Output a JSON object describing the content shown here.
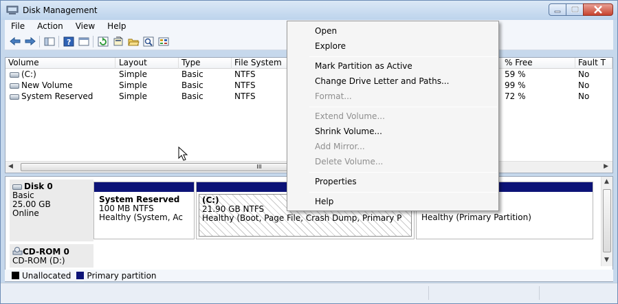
{
  "window": {
    "title": "Disk Management"
  },
  "menubar": [
    "File",
    "Action",
    "View",
    "Help"
  ],
  "toolbar": {
    "buttons": [
      "back-icon",
      "forward-icon",
      "console-tree-icon",
      "help-icon",
      "properties-icon",
      "refresh-icon",
      "rescan-icon",
      "open-icon",
      "find-icon",
      "view-icon"
    ]
  },
  "volumes": {
    "columns": [
      "Volume",
      "Layout",
      "Type",
      "File System",
      "% Free",
      "Fault T"
    ],
    "rows": [
      {
        "volume": "(C:)",
        "layout": "Simple",
        "type": "Basic",
        "fs": "NTFS",
        "free": "59 %",
        "fault": "No"
      },
      {
        "volume": "New Volume",
        "layout": "Simple",
        "type": "Basic",
        "fs": "NTFS",
        "free": "99 %",
        "fault": "No"
      },
      {
        "volume": "System Reserved",
        "layout": "Simple",
        "type": "Basic",
        "fs": "NTFS",
        "free": "72 %",
        "fault": "No"
      }
    ],
    "scroll_thumb": "III"
  },
  "disks": {
    "disk0": {
      "name": "Disk 0",
      "type": "Basic",
      "size": "25.00 GB",
      "status": "Online"
    },
    "partitions": [
      {
        "name": "System Reserved",
        "size": "100 MB NTFS",
        "status": "Healthy (System, Ac"
      },
      {
        "name": "(C:)",
        "size": "21.90 GB NTFS",
        "status": "Healthy (Boot, Page File, Crash Dump, Primary P"
      },
      {
        "name": "",
        "size": "",
        "status": "Healthy (Primary Partition)"
      }
    ],
    "cdrom": {
      "name": "CD-ROM 0",
      "drive": "CD-ROM (D:)"
    }
  },
  "legend": [
    {
      "label": "Unallocated",
      "color": "#000000"
    },
    {
      "label": "Primary partition",
      "color": "#0c1377"
    }
  ],
  "context_menu": {
    "items": [
      {
        "label": "Open",
        "enabled": true
      },
      {
        "label": "Explore",
        "enabled": true
      },
      {
        "label": "Mark Partition as Active",
        "enabled": true
      },
      {
        "label": "Change Drive Letter and Paths...",
        "enabled": true
      },
      {
        "label": "Format...",
        "enabled": false
      },
      {
        "label": "Extend Volume...",
        "enabled": false
      },
      {
        "label": "Shrink Volume...",
        "enabled": true
      },
      {
        "label": "Add Mirror...",
        "enabled": false
      },
      {
        "label": "Delete Volume...",
        "enabled": false
      },
      {
        "label": "Properties",
        "enabled": true
      },
      {
        "label": "Help",
        "enabled": true
      }
    ]
  }
}
